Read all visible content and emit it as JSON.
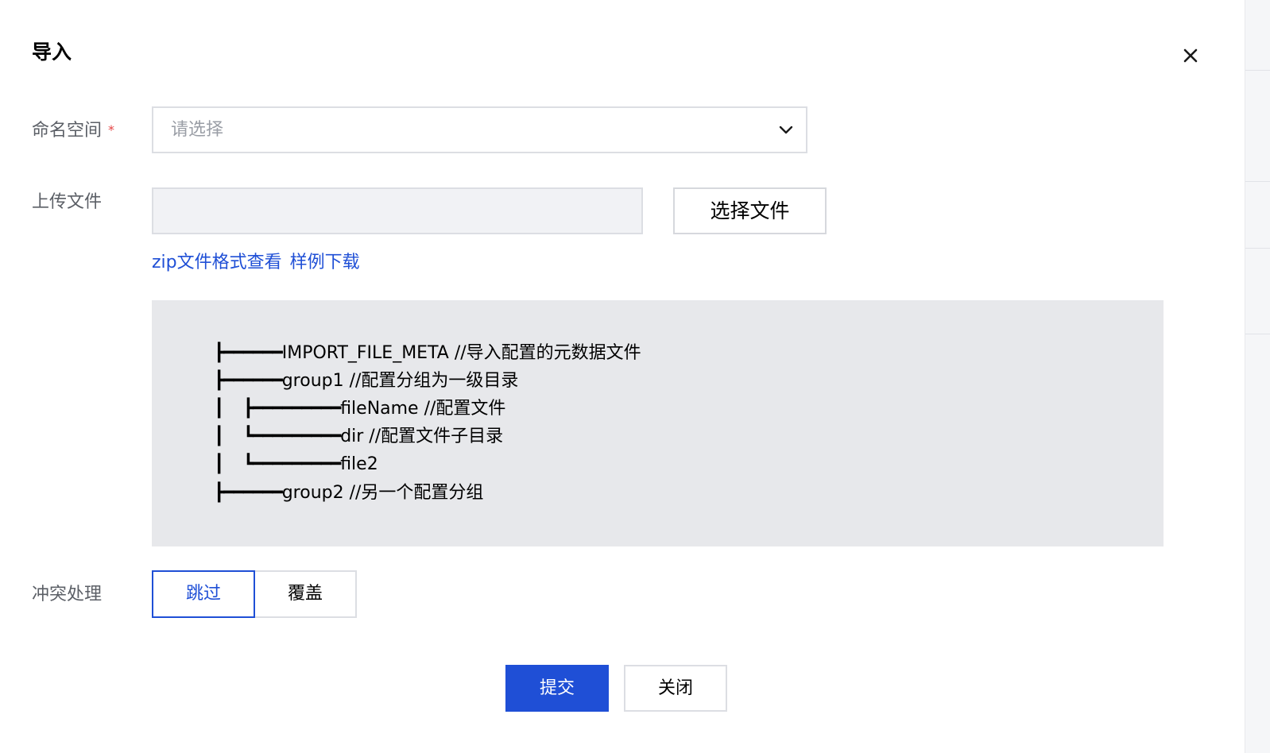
{
  "dialog": {
    "title": "导入",
    "close_icon": "close-icon"
  },
  "form": {
    "namespace": {
      "label": "命名空间",
      "required_mark": "*",
      "placeholder": "请选择",
      "chevron_icon": "chevron-down-icon"
    },
    "upload": {
      "label": "上传文件",
      "file_value": "",
      "choose_button": "选择文件",
      "format_link": "zip文件格式查看",
      "sample_link": "样例下载"
    },
    "tree": [
      {
        "glyph": "┣━━━━━━",
        "text": "IMPORT_FILE_META //导入配置的元数据文件"
      },
      {
        "glyph": "┣━━━━━━",
        "text": "group1 //配置分组为一级目录"
      },
      {
        "glyph": "┃  ┣━━━━━━━━━",
        "text": "fileName //配置文件"
      },
      {
        "glyph": "┃  ┗━━━━━━━━━",
        "text": "dir //配置文件子目录"
      },
      {
        "glyph": "┃  ┗━━━━━━━━━",
        "text": "file2"
      },
      {
        "glyph": "┣━━━━━━",
        "text": "group2 //另一个配置分组"
      }
    ],
    "conflict": {
      "label": "冲突处理",
      "options": [
        "跳过",
        "覆盖"
      ],
      "selected": "跳过"
    }
  },
  "footer": {
    "submit": "提交",
    "close": "关闭"
  },
  "colors": {
    "primary": "#1f4fd6",
    "required": "#e54545",
    "tree_background": "#e7e8eb",
    "label_text": "#5b5f66"
  }
}
